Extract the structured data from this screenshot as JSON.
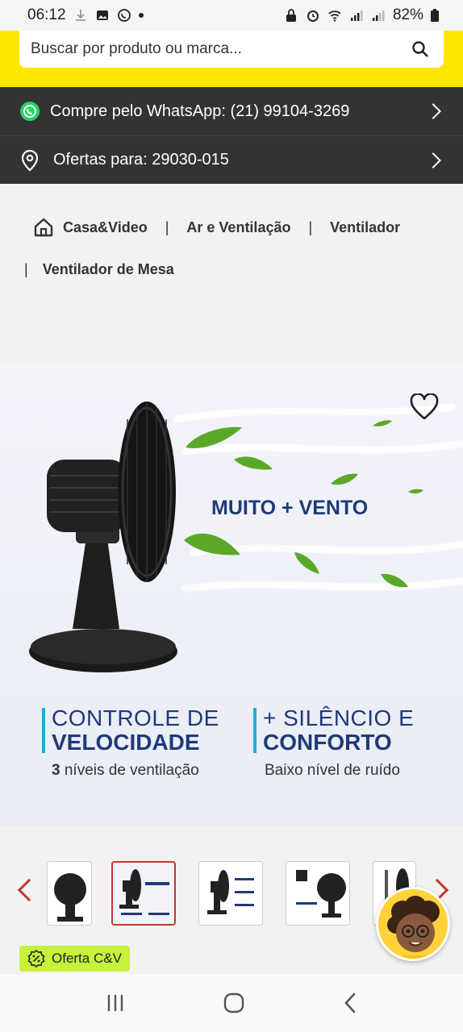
{
  "status_bar": {
    "time": "06:12",
    "battery": "82%"
  },
  "search": {
    "placeholder": "Buscar por produto ou marca..."
  },
  "whatsapp_bar": {
    "label": "Compre pelo WhatsApp: (21) 99104-3269"
  },
  "location_bar": {
    "label": "Ofertas para: 29030-015"
  },
  "breadcrumb": {
    "items": [
      "Casa&Video",
      "Ar e Ventilação",
      "Ventilador",
      "Ventilador de Mesa"
    ],
    "separator": "|"
  },
  "product_image": {
    "headline": "MUITO + VENTO",
    "feature_1": {
      "line1": "CONTROLE DE",
      "line2": "VELOCIDADE",
      "sub_bold": "3",
      "sub_rest": " níveis de ventilação"
    },
    "feature_2": {
      "line1": "+ SILÊNCIO E",
      "line2": "CONFORTO",
      "sub": "Baixo nível de ruído"
    }
  },
  "offer_badge": {
    "label": "Oferta C&V"
  },
  "colors": {
    "brand_yellow": "#ffe600",
    "dark_bar": "#333333",
    "accent_red": "#c0392b",
    "offer_green": "#c6f23a",
    "headline_blue": "#1f3a7a"
  },
  "icons": [
    "whatsapp-icon",
    "location-pin-icon",
    "search-icon",
    "home-icon",
    "heart-icon",
    "chevron-right-icon",
    "arrow-left-icon",
    "arrow-right-icon",
    "badge-percent-icon"
  ]
}
